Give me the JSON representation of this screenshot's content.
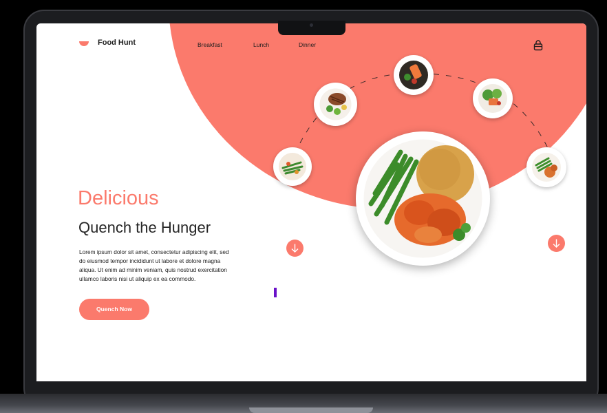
{
  "brand": {
    "name": "Food Hunt"
  },
  "nav": {
    "breakfast": "Breakfast",
    "lunch": "Lunch",
    "dinner": "Dinner"
  },
  "hero": {
    "accent": "Delicious",
    "title": "Quench the Hunger",
    "body": "Lorem ipsum dolor sit amet, consectetur adipiscing elit, sed do eiusmod tempor incididunt ut labore et dolore magna aliqua. Ut enim ad minim veniam, quis nostrud exercitation ullamco laboris nisi ut aliquip ex ea commodo.",
    "cta": "Quench Now"
  },
  "icons": {
    "logo": "bowl-icon",
    "cart": "shopping-bag-icon",
    "arrow": "arrow-down-icon"
  },
  "colors": {
    "accent": "#fb7a6c",
    "text": "#262626",
    "caret": "#6a12c9"
  },
  "dishes": [
    "salad-plate",
    "steak-plate",
    "salmon-bowl",
    "salmon-salad-plate",
    "green-bean-plate",
    "main-chicken-plate"
  ]
}
